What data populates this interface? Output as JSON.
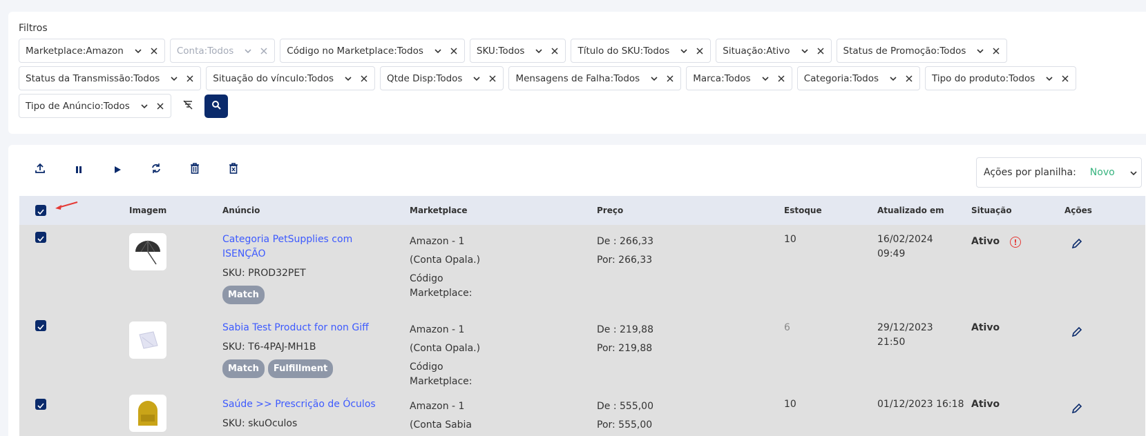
{
  "filters": {
    "title": "Filtros",
    "row1": [
      {
        "label": "Marketplace:",
        "value": " Amazon",
        "disabled": false
      },
      {
        "label": "Conta:",
        "value": " Todos",
        "disabled": true
      },
      {
        "label": "Código no Marketplace:",
        "value": "Todos",
        "disabled": false
      },
      {
        "label": "SKU:",
        "value": "Todos",
        "disabled": false
      },
      {
        "label": "Título do SKU:",
        "value": "Todos",
        "disabled": false
      },
      {
        "label": "Situação:",
        "value": "Ativo",
        "disabled": false
      },
      {
        "label": "Status de Promoção:",
        "value": "Todos",
        "disabled": false
      }
    ],
    "row2": [
      {
        "label": "Status da Transmissão:",
        "value": "Todos"
      },
      {
        "label": "Situação do vínculo:",
        "value": "Todos"
      },
      {
        "label": "Qtde Disp:",
        "value": "Todos"
      },
      {
        "label": "Mensagens de Falha:",
        "value": " Todos"
      },
      {
        "label": "Marca:",
        "value": "Todos"
      },
      {
        "label": "Categoria:",
        "value": "Todos"
      },
      {
        "label": "Tipo do produto:",
        "value": "Todos"
      }
    ],
    "row3": [
      {
        "label": "Tipo de Anúncio:",
        "value": "Todos"
      }
    ]
  },
  "toolbar": {
    "icons": [
      "upload-icon",
      "pause-icon",
      "play-icon",
      "sync-icon",
      "trash-icon",
      "delete-box-icon"
    ],
    "sheet_actions_label": "Ações por planilha:",
    "sheet_actions_value": "Novo"
  },
  "table": {
    "headers": {
      "image": "Imagem",
      "listing": "Anúncio",
      "marketplace": "Marketplace",
      "price": "Preço",
      "stock": "Estoque",
      "updated": "Atualizado em",
      "status": "Situação",
      "actions": "Ações"
    },
    "rows": [
      {
        "title_line1": "Categoria PetSupplies com",
        "title_line2": "ISENÇÃO",
        "sku": "SKU: PROD32PET",
        "badges": [
          "Match"
        ],
        "mk1": "Amazon - 1",
        "mk2": "(Conta Opala.)",
        "mk3": "Código",
        "mk4": "Marketplace:",
        "price_de": "De : 266,33",
        "price_por": "Por: 266,33",
        "stock": "10",
        "updated1": "16/02/2024",
        "updated2": "09:49",
        "status": "Ativo",
        "warning": "!"
      },
      {
        "title_line1": "Sabia Test Product for non Giff",
        "title_line2": "",
        "sku": "SKU: T6-4PAJ-MH1B",
        "badges": [
          "Match",
          "Fulfillment"
        ],
        "mk1": "Amazon - 1",
        "mk2": "(Conta Opala.)",
        "mk3": "Código",
        "mk4": "Marketplace:",
        "price_de": "De : 219,88",
        "price_por": "Por: 219,88",
        "stock": "6",
        "updated1": "29/12/2023",
        "updated2": "21:50",
        "status": "Ativo",
        "warning": ""
      },
      {
        "title_line1": "Saúde >> Prescrição de Óculos",
        "title_line2": "",
        "sku": "SKU: skuOculos",
        "badges": [],
        "mk1": "Amazon - 1",
        "mk2": "(Conta Sabia",
        "mk3": "",
        "mk4": "",
        "price_de": "De : 555,00",
        "price_por": "Por: 555,00",
        "stock": "10",
        "updated1": "01/12/2023 16:18",
        "updated2": "",
        "status": "Ativo",
        "warning": ""
      }
    ]
  },
  "colors": {
    "primary": "#0a2a6b",
    "link": "#3d5afe",
    "success": "#36b37e",
    "danger": "#e53935",
    "badge": "#8e97a8"
  }
}
